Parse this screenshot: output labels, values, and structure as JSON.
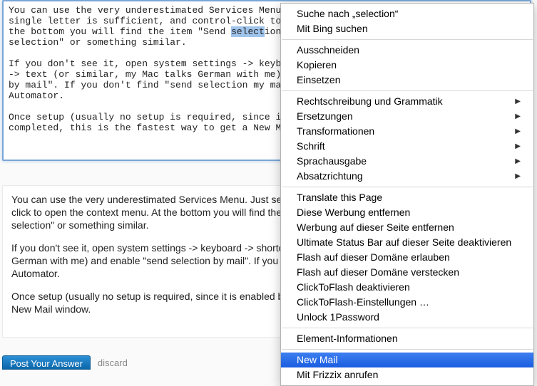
{
  "editor": {
    "selection_word": "select",
    "text_before": "You can use the very underestimated Services Menu. Just select a word (a\nsingle letter is sufficient, and control-click to open the context menu. At\nthe bottom you will find the item \"Send ",
    "text_after": "ion by mail\" or \"New mail with\nselection\" or something similar.\n\nIf you don't see it, open system settings -> keyboard -> shortcuts -> services\n-> text (or similar, my Mac talks German with me) and enable \"send selection\nby mail\". If you don't find \"send selection my mail\" just add it using the\nAutomator.\n\nOnce setup (usually no setup is required, since it is enabled by default) is\ncompleted, this is the fastest way to get a New Mail window."
  },
  "preview": {
    "p1": "You can use the very underestimated Services Menu. Just select a word (a single letter is sufficient, and control-click to open the context menu. At the bottom you will find the item \"Send selection by mail\" or \"New mail with selection\" or something similar.",
    "p2": "If you don't see it, open system settings -> keyboard -> shortcuts -> services -> text (or similar, my Mac talks German with me) and enable \"send selection by mail\". If you don't find \"send selection my mail\" just add it using the Automator.",
    "p3": "Once setup (usually no setup is required, since it is enabled by default) is completed, this is the fastest way to get a New Mail window."
  },
  "post_bar": {
    "post_label": "Post Your Answer",
    "discard_label": "discard"
  },
  "context_menu": {
    "groups": [
      [
        {
          "label": "Suche nach „selection“",
          "sub": false
        },
        {
          "label": "Mit Bing suchen",
          "sub": false
        }
      ],
      [
        {
          "label": "Ausschneiden",
          "sub": false
        },
        {
          "label": "Kopieren",
          "sub": false
        },
        {
          "label": "Einsetzen",
          "sub": false
        }
      ],
      [
        {
          "label": "Rechtschreibung und Grammatik",
          "sub": true
        },
        {
          "label": "Ersetzungen",
          "sub": true
        },
        {
          "label": "Transformationen",
          "sub": true
        },
        {
          "label": "Schrift",
          "sub": true
        },
        {
          "label": "Sprachausgabe",
          "sub": true
        },
        {
          "label": "Absatzrichtung",
          "sub": true
        }
      ],
      [
        {
          "label": "Translate this Page",
          "sub": false
        },
        {
          "label": "Diese Werbung entfernen",
          "sub": false
        },
        {
          "label": "Werbung auf dieser Seite entfernen",
          "sub": false
        },
        {
          "label": "Ultimate Status Bar auf dieser Seite deaktivieren",
          "sub": false
        },
        {
          "label": "Flash auf dieser Domäne erlauben",
          "sub": false
        },
        {
          "label": "Flash auf dieser Domäne verstecken",
          "sub": false
        },
        {
          "label": "ClickToFlash deaktivieren",
          "sub": false
        },
        {
          "label": "ClickToFlash-Einstellungen …",
          "sub": false
        },
        {
          "label": "Unlock 1Password",
          "sub": false
        }
      ],
      [
        {
          "label": "Element-Informationen",
          "sub": false
        }
      ],
      [
        {
          "label": "New Mail",
          "sub": false,
          "highlight": true
        },
        {
          "label": "Mit Frizzix anrufen",
          "sub": false
        }
      ]
    ]
  }
}
